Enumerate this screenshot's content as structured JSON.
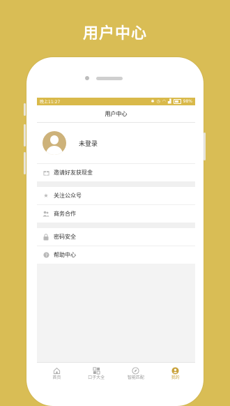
{
  "promo": {
    "title": "用户中心"
  },
  "status_bar": {
    "time": "晚上11:27",
    "battery": "98%"
  },
  "nav": {
    "title": "用户中心"
  },
  "user": {
    "name": "未登录"
  },
  "menu_groups": [
    {
      "items": [
        {
          "label": "邀请好友获现金",
          "icon": "gift-icon"
        }
      ]
    },
    {
      "items": [
        {
          "label": "关注公众号",
          "icon": "star-icon"
        },
        {
          "label": "商务合作",
          "icon": "people-icon"
        }
      ]
    },
    {
      "items": [
        {
          "label": "密码安全",
          "icon": "lock-icon"
        },
        {
          "label": "帮助中心",
          "icon": "help-icon"
        }
      ]
    }
  ],
  "tabs": [
    {
      "label": "首页",
      "icon": "home-icon",
      "active": false
    },
    {
      "label": "口子大全",
      "icon": "grid-icon",
      "active": false
    },
    {
      "label": "智能匹配",
      "icon": "compass-icon",
      "active": false
    },
    {
      "label": "我的",
      "icon": "profile-icon",
      "active": true
    }
  ],
  "colors": {
    "background": "#D9BD55",
    "accent": "#C9A23B",
    "status_bar": "#D9B94A",
    "avatar": "#CDB27A"
  }
}
